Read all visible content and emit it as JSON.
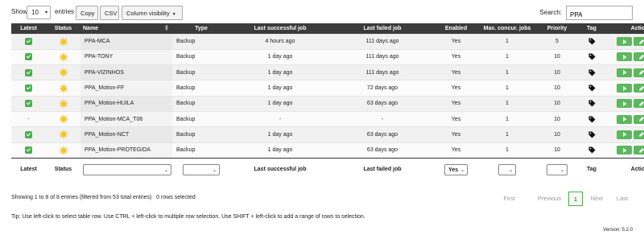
{
  "length_control": {
    "show_label": "Show",
    "value": "10",
    "entries_label": "entries"
  },
  "buttons": {
    "copy": "Copy",
    "csv": "CSV",
    "column_visibility": "Column visibility"
  },
  "search": {
    "label": "Search:",
    "value": "PPA"
  },
  "columns": [
    "Latest",
    "Status",
    "Name",
    "Type",
    "Last successful job",
    "Last failed job",
    "Enabled",
    "Max. concur. jobs",
    "Priority",
    "Tag",
    "Actions"
  ],
  "rows": [
    {
      "latest": true,
      "name": "PPA-MCA",
      "type": "Backup",
      "last_success": "4 hours ago",
      "last_failed": "111 days ago",
      "enabled": "Yes",
      "max_jobs": "1",
      "priority": "5"
    },
    {
      "latest": true,
      "name": "PPA-TONY",
      "type": "Backup",
      "last_success": "1 day ago",
      "last_failed": "111 days ago",
      "enabled": "Yes",
      "max_jobs": "1",
      "priority": "10"
    },
    {
      "latest": true,
      "name": "PPA-VIZINHOS",
      "type": "Backup",
      "last_success": "1 day ago",
      "last_failed": "111 days ago",
      "enabled": "Yes",
      "max_jobs": "1",
      "priority": "10"
    },
    {
      "latest": true,
      "name": "PPA_Motion-FF",
      "type": "Backup",
      "last_success": "1 day ago",
      "last_failed": "72 days ago",
      "enabled": "Yes",
      "max_jobs": "1",
      "priority": "10"
    },
    {
      "latest": true,
      "name": "PPA_Motion-HUILA",
      "type": "Backup",
      "last_success": "1 day ago",
      "last_failed": "63 days ago",
      "enabled": "Yes",
      "max_jobs": "1",
      "priority": "10"
    },
    {
      "latest": false,
      "name": "PPA_Motion-MCA_T06",
      "type": "Backup",
      "last_success": "-",
      "last_failed": "-",
      "enabled": "Yes",
      "max_jobs": "1",
      "priority": "10"
    },
    {
      "latest": true,
      "name": "PPA_Motion-NCT",
      "type": "Backup",
      "last_success": "1 day ago",
      "last_failed": "63 days ago",
      "enabled": "Yes",
      "max_jobs": "1",
      "priority": "10"
    },
    {
      "latest": true,
      "name": "PPA_Motion-PROTEGIDA",
      "type": "Backup",
      "last_success": "1 day ago",
      "last_failed": "63 days ago",
      "enabled": "Yes",
      "max_jobs": "1",
      "priority": "10"
    }
  ],
  "no_latest_text": "-",
  "footer": {
    "latest": "Latest",
    "status": "Status",
    "last_success": "Last successful job",
    "last_failed": "Last failed job",
    "enabled_filter": "Yes",
    "tag": "Tag",
    "actions": "Actions"
  },
  "info_text": "Showing 1 to 8 of 8 entries (filtered from 53 total entries)   0 rows selected",
  "pagination": {
    "first": "First",
    "previous": "Previous",
    "current": "1",
    "next": "Next",
    "last": "Last"
  },
  "tip": "Tip: Use left-click to select table row. Use CTRL + left-click to multiple row selection. Use SHIFT + left-click to add a range of rows to selection.",
  "version": "Version: 5.2.0",
  "colors": {
    "header_bg": "#3b3b3b",
    "accent_green": "#5cb85c",
    "status_icon": "#f5b800"
  },
  "icons": {
    "status": "sun-icon",
    "tag": "tag-icon",
    "actions": [
      "run-icon",
      "edit-icon",
      "details-icon"
    ]
  }
}
